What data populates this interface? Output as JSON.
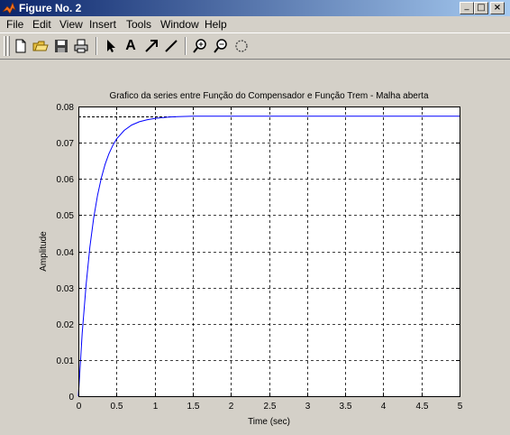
{
  "window": {
    "title": "Figure No. 2",
    "minimize": "_",
    "maximize": "□",
    "close": "×"
  },
  "menu": [
    "File",
    "Edit",
    "View",
    "Insert",
    "Tools",
    "Window",
    "Help"
  ],
  "toolbar": {
    "buttons": [
      "new-file-icon",
      "open-folder-icon",
      "save-icon",
      "print-icon",
      "select-arrow-icon",
      "insert-text-icon",
      "insert-arrow-icon",
      "insert-line-icon",
      "zoom-in-icon",
      "zoom-out-icon",
      "rotate-icon"
    ],
    "text_button_label": "A"
  },
  "chart_data": {
    "type": "line",
    "title": "Grafico da series entre Função do Compensador e Função Trem - Malha aberta",
    "xlabel": "Time (sec)",
    "ylabel": "Amplitude",
    "xlim": [
      0,
      5
    ],
    "ylim": [
      0,
      0.08
    ],
    "xticks": [
      "0",
      "0.5",
      "1",
      "1.5",
      "2",
      "2.5",
      "3",
      "3.5",
      "4",
      "4.5",
      "5"
    ],
    "yticks": [
      "0",
      "0.01",
      "0.02",
      "0.03",
      "0.04",
      "0.05",
      "0.06",
      "0.07",
      "0.08"
    ],
    "grid": true,
    "steady_state": 0.0773,
    "series": [
      {
        "color": "#0000ff",
        "x": [
          0,
          0.05,
          0.1,
          0.15,
          0.2,
          0.25,
          0.3,
          0.35,
          0.4,
          0.45,
          0.5,
          0.6,
          0.7,
          0.8,
          0.9,
          1.0,
          1.1,
          1.2,
          1.3,
          1.5,
          2,
          3,
          4,
          5
        ],
        "y": [
          0,
          0.0173,
          0.0306,
          0.0411,
          0.0491,
          0.0554,
          0.0602,
          0.064,
          0.0669,
          0.0692,
          0.071,
          0.0734,
          0.0749,
          0.0758,
          0.0763,
          0.0767,
          0.0769,
          0.0771,
          0.0772,
          0.0773,
          0.0773,
          0.0773,
          0.0773,
          0.0773
        ]
      }
    ]
  }
}
